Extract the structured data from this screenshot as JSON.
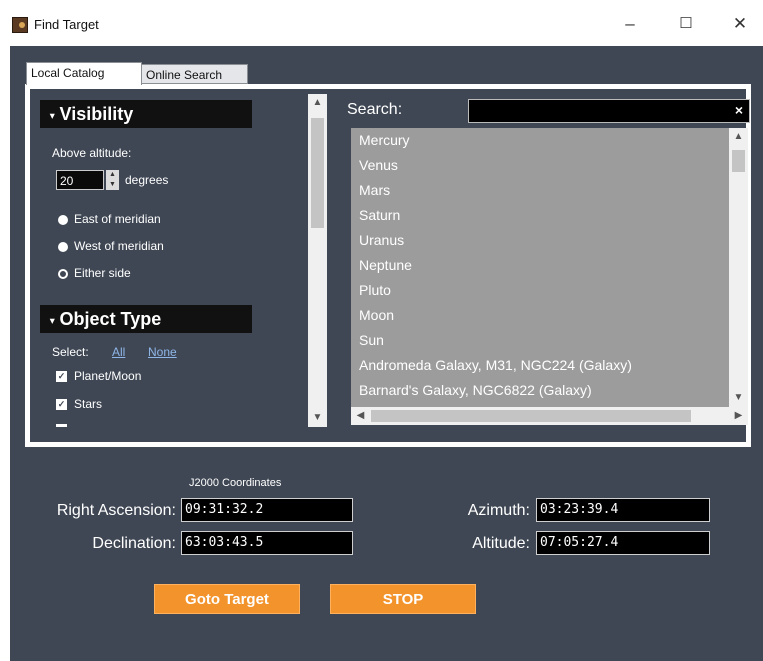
{
  "window": {
    "title": "Find Target",
    "minimize": "–",
    "maximize": "☐",
    "close": "✕"
  },
  "tabs": [
    {
      "label": "Local Catalog",
      "active": true
    },
    {
      "label": "Online Search",
      "active": false
    }
  ],
  "visibility": {
    "heading": "Visibility",
    "above_altitude_label": "Above altitude:",
    "altitude_value": "20",
    "degrees_label": "degrees",
    "options": [
      {
        "label": "East of meridian",
        "selected": false
      },
      {
        "label": "West of meridian",
        "selected": false
      },
      {
        "label": "Either side",
        "selected": true
      }
    ]
  },
  "object_type": {
    "heading": "Object Type",
    "select_label": "Select:",
    "all_link": "All",
    "none_link": "None",
    "items": [
      {
        "label": "Planet/Moon",
        "checked": true
      },
      {
        "label": "Stars",
        "checked": true
      }
    ]
  },
  "search": {
    "label": "Search:",
    "value": "",
    "clear": "×"
  },
  "targets": [
    "Mercury",
    "Venus",
    "Mars",
    "Saturn",
    "Uranus",
    "Neptune",
    "Pluto",
    "Moon",
    "Sun",
    "Andromeda Galaxy, M31, NGC224 (Galaxy)",
    "Barnard's Galaxy, NGC6822 (Galaxy)"
  ],
  "coordinates": {
    "title": "J2000 Coordinates",
    "ra_label": "Right Ascension:",
    "ra_value": "09:31:32.2",
    "dec_label": "Declination:",
    "dec_value": "63:03:43.5",
    "az_label": "Azimuth:",
    "az_value": "03:23:39.4",
    "alt_label": "Altitude:",
    "alt_value": "07:05:27.4"
  },
  "buttons": {
    "goto": "Goto Target",
    "stop": "STOP"
  },
  "colors": {
    "background": "#3f4754",
    "accent": "#f2932c",
    "list_bg": "#9c9c9c"
  }
}
